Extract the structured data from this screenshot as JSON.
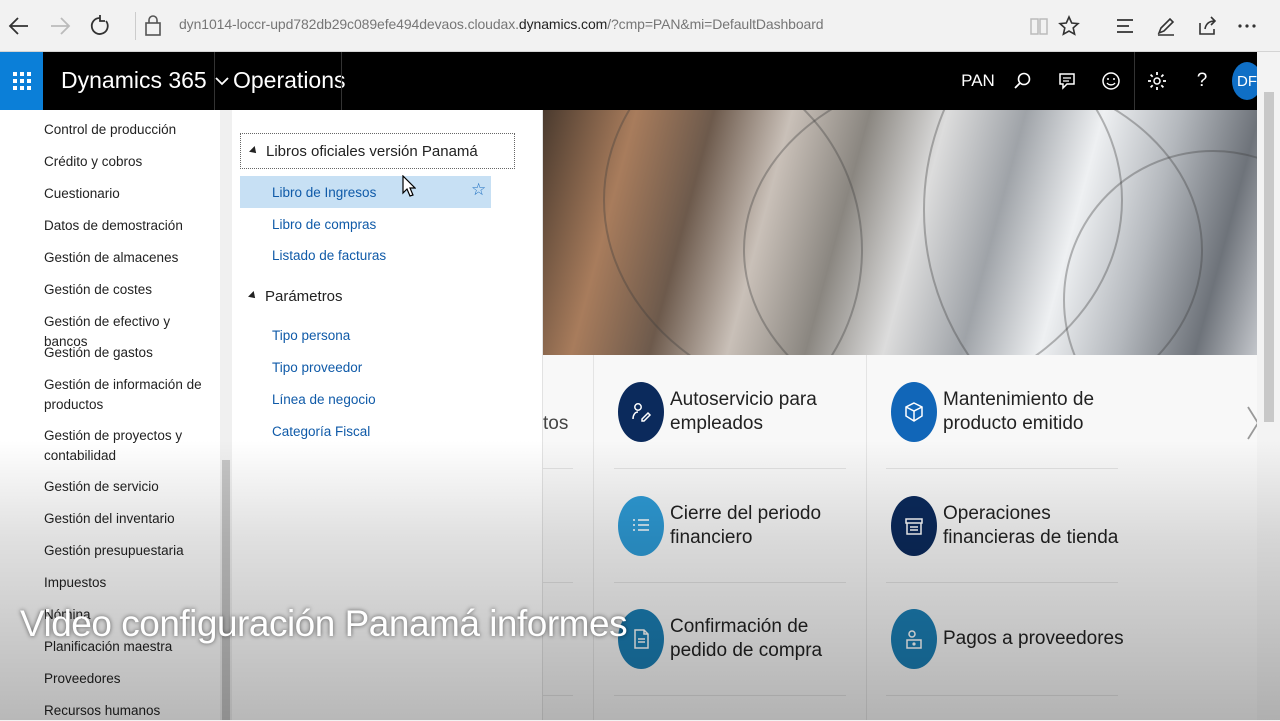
{
  "browser": {
    "url_prefix": "dyn1014-loccr-upd782db29c089efe494devaos.cloudax.",
    "url_domain": "dynamics.com",
    "url_suffix": "/?cmp=PAN&mi=DefaultDashboard"
  },
  "header": {
    "app_name": "Dynamics 365",
    "module": "Operations",
    "company": "PAN",
    "avatar": "DF",
    "accent": "#0b7fd8"
  },
  "nav_modules": [
    "Control de producción",
    "Crédito y cobros",
    "Cuestionario",
    "Datos de demostración",
    "Gestión de almacenes",
    "Gestión de costes",
    "Gestión de efectivo y bancos",
    "Gestión de gastos",
    "Gestión de información de productos",
    "Gestión de proyectos y contabilidad",
    "Gestión de servicio",
    "Gestión del inventario",
    "Gestión presupuestaria",
    "Impuestos",
    "Nómina",
    "Planificación maestra",
    "Proveedores",
    "Recursos humanos"
  ],
  "flyout": {
    "group1": {
      "title": "Libros oficiales versión Panamá",
      "links": [
        "Libro de Ingresos",
        "Libro de compras",
        "Listado de facturas"
      ]
    },
    "group2": {
      "title": "Parámetros",
      "links": [
        "Tipo persona",
        "Tipo proveedor",
        "Línea de negocio",
        "Categoría Fiscal"
      ]
    }
  },
  "tiles": {
    "partial_text": "tos",
    "items": [
      {
        "label": "Autoservicio para empleados",
        "icon": "person-edit-icon",
        "color": "#0b2a5c"
      },
      {
        "label": "Mantenimiento de producto emitido",
        "icon": "box-icon",
        "color": "#1166b8"
      },
      {
        "label": "Cierre del periodo financiero",
        "icon": "list-icon",
        "color": "#2e9bd6"
      },
      {
        "label": "Operaciones financieras de tienda",
        "icon": "store-icon",
        "color": "#0b2a5c"
      },
      {
        "label": "Confirmación de pedido de compra",
        "icon": "document-icon",
        "color": "#1b7fb5"
      },
      {
        "label": "Pagos a proveedores",
        "icon": "payment-icon",
        "color": "#1b7fb5"
      }
    ]
  },
  "caption": "Video configuración Panamá informes"
}
